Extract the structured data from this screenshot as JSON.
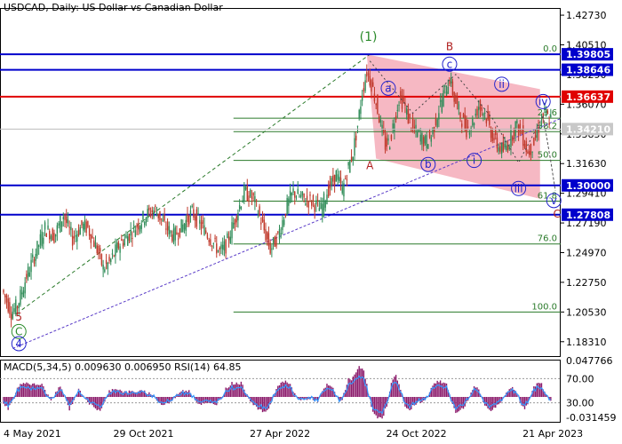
{
  "header": {
    "symbol": "USDCAD",
    "timeframe": "Daily:",
    "description": "US Dollar vs Canadian Dollar"
  },
  "indicator_label": "MACD(5,34,5) 0.009630 0.006950 RSI(14) 64.85",
  "colors": {
    "bull_candle": "#2e8b57",
    "bear_candle": "#c0392b",
    "blue_level": "#0000cc",
    "red_level": "#e00000",
    "fib_green": "#2a7a2a",
    "channel_fill": "#f4a6b4",
    "support_line": "#5a3cc8",
    "macd_hist": "#8b1a6b",
    "macd_signal": "#3399ff",
    "wave_green": "#2a8a2a",
    "wave_blue": "#2222cc",
    "wave_red": "#b02020"
  },
  "chart_data": [
    {
      "type": "candlestick",
      "symbol": "USDCAD",
      "timeframe": "Daily",
      "x_tick_labels": [
        "4 May 2021",
        "29 Oct 2021",
        "27 Apr 2022",
        "24 Oct 2022",
        "21 Apr 2023"
      ],
      "y_tick_labels": [
        "1.42730",
        "1.40510",
        "1.38290",
        "1.36070",
        "1.33850",
        "1.31630",
        "1.29410",
        "1.27190",
        "1.24970",
        "1.22750",
        "1.20530",
        "1.18310"
      ],
      "ylim": [
        1.173,
        1.432
      ],
      "price_path": [
        [
          0,
          1.222
        ],
        [
          6,
          1.205
        ],
        [
          10,
          1.21
        ],
        [
          16,
          1.232
        ],
        [
          22,
          1.25
        ],
        [
          28,
          1.268
        ],
        [
          34,
          1.262
        ],
        [
          40,
          1.278
        ],
        [
          46,
          1.26
        ],
        [
          52,
          1.27
        ],
        [
          56,
          1.268
        ],
        [
          62,
          1.252
        ],
        [
          66,
          1.238
        ],
        [
          70,
          1.242
        ],
        [
          76,
          1.255
        ],
        [
          82,
          1.262
        ],
        [
          88,
          1.27
        ],
        [
          94,
          1.278
        ],
        [
          100,
          1.282
        ],
        [
          106,
          1.27
        ],
        [
          112,
          1.262
        ],
        [
          118,
          1.27
        ],
        [
          124,
          1.28
        ],
        [
          130,
          1.27
        ],
        [
          136,
          1.26
        ],
        [
          142,
          1.25
        ],
        [
          146,
          1.255
        ],
        [
          152,
          1.275
        ],
        [
          158,
          1.295
        ],
        [
          164,
          1.29
        ],
        [
          170,
          1.27
        ],
        [
          175,
          1.252
        ],
        [
          180,
          1.262
        ],
        [
          186,
          1.285
        ],
        [
          190,
          1.295
        ],
        [
          196,
          1.29
        ],
        [
          202,
          1.288
        ],
        [
          208,
          1.282
        ],
        [
          212,
          1.295
        ],
        [
          218,
          1.308
        ],
        [
          222,
          1.296
        ],
        [
          225,
          1.31
        ],
        [
          229,
          1.325
        ],
        [
          232,
          1.345
        ],
        [
          235,
          1.37
        ],
        [
          238,
          1.385
        ],
        [
          241,
          1.376
        ],
        [
          244,
          1.362
        ],
        [
          247,
          1.345
        ],
        [
          250,
          1.33
        ],
        [
          253,
          1.333
        ],
        [
          256,
          1.35
        ],
        [
          259,
          1.365
        ],
        [
          262,
          1.362
        ],
        [
          265,
          1.35
        ],
        [
          268,
          1.342
        ],
        [
          272,
          1.338
        ],
        [
          276,
          1.332
        ],
        [
          280,
          1.337
        ],
        [
          284,
          1.353
        ],
        [
          288,
          1.368
        ],
        [
          292,
          1.38
        ],
        [
          295,
          1.365
        ],
        [
          299,
          1.352
        ],
        [
          303,
          1.342
        ],
        [
          307,
          1.347
        ],
        [
          311,
          1.36
        ],
        [
          315,
          1.354
        ],
        [
          319,
          1.34
        ],
        [
          323,
          1.33
        ],
        [
          327,
          1.326
        ],
        [
          331,
          1.333
        ],
        [
          335,
          1.345
        ],
        [
          339,
          1.339
        ],
        [
          343,
          1.324
        ],
        [
          347,
          1.332
        ],
        [
          351,
          1.347
        ],
        [
          354,
          1.354
        ],
        [
          357,
          1.349
        ]
      ],
      "resistance_levels": [
        {
          "label": "1.39805",
          "value": 1.39805,
          "color": "blue"
        },
        {
          "label": "1.38646",
          "value": 1.38646,
          "color": "blue"
        },
        {
          "label": "1.36637",
          "value": 1.36637,
          "color": "red"
        },
        {
          "label": "1.30000",
          "value": 1.3,
          "color": "blue"
        },
        {
          "label": "1.27808",
          "value": 1.27808,
          "color": "blue"
        }
      ],
      "current_price_label": "1.34210",
      "current_price": 1.3421,
      "fibonacci_levels": [
        {
          "label": "0.0",
          "value": 1.39805
        },
        {
          "label": "23.6",
          "value": 1.3502
        },
        {
          "label": "38.2",
          "value": 1.3402
        },
        {
          "label": "50.0",
          "value": 1.3187
        },
        {
          "label": "61.8",
          "value": 1.2882
        },
        {
          "label": "76.0",
          "value": 1.2562
        },
        {
          "label": "100.0",
          "value": 1.2053
        }
      ],
      "wave_labels": [
        {
          "text": "(1)",
          "style": "green"
        },
        {
          "text": "B",
          "style": "red"
        },
        {
          "text": "A",
          "style": "red"
        },
        {
          "text": "5",
          "style": "red"
        },
        {
          "text": "C",
          "style": "green-circle"
        },
        {
          "text": "4",
          "style": "blue-circle"
        },
        {
          "text": "a",
          "style": "blue-circle"
        },
        {
          "text": "b",
          "style": "blue-circle"
        },
        {
          "text": "c",
          "style": "blue-circle"
        },
        {
          "text": "i",
          "style": "blue-circle"
        },
        {
          "text": "ii",
          "style": "blue-circle"
        },
        {
          "text": "iii",
          "style": "blue-circle"
        },
        {
          "text": "iv",
          "style": "blue-circle"
        },
        {
          "text": "v",
          "style": "blue-circle"
        },
        {
          "text": "C",
          "style": "red"
        }
      ]
    },
    {
      "type": "histogram",
      "indicator": "MACD(5,34,5) with RSI(14)",
      "macd": 0.00963,
      "signal": 0.00695,
      "rsi": 64.85,
      "y_tick_labels": [
        "0.047766",
        "70.00",
        "30.00",
        "-0.031459"
      ],
      "rsi_levels": [
        70,
        30
      ],
      "ylim": [
        -0.031459,
        0.047766
      ]
    }
  ]
}
